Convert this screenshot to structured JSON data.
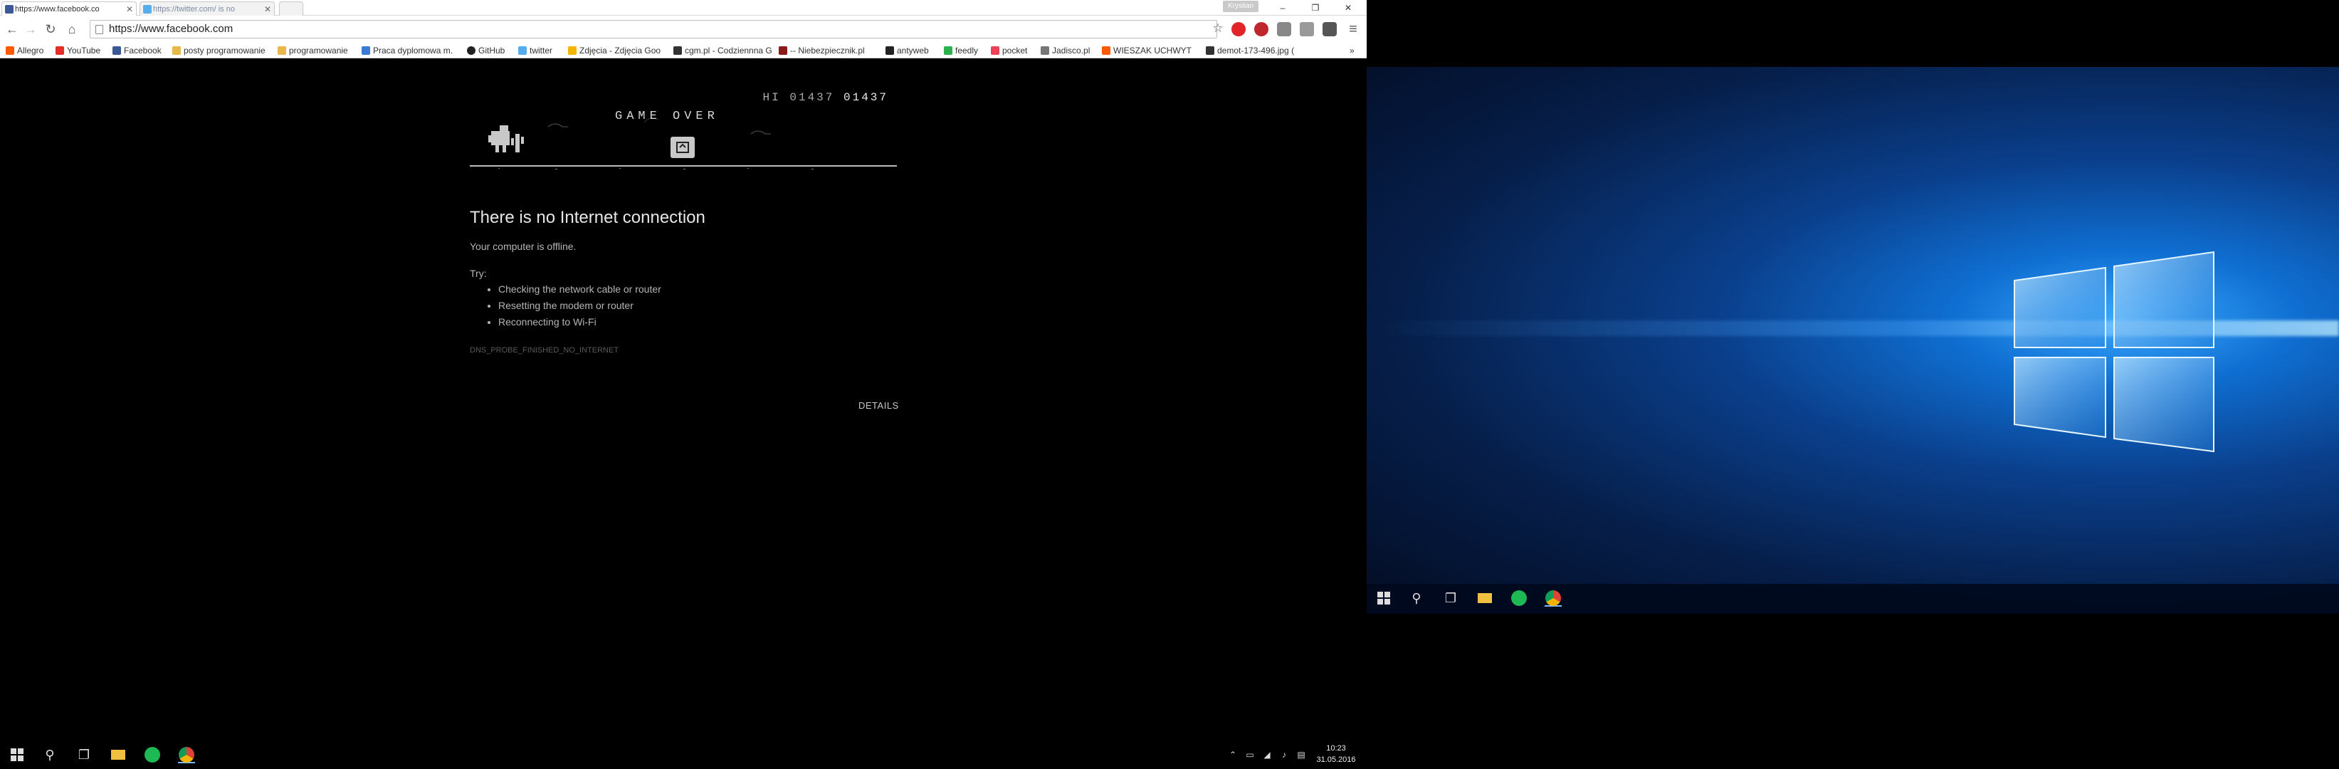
{
  "browser": {
    "tabs": [
      {
        "title": "https://www.facebook.co",
        "active": true,
        "favicon_color": "#3b5998"
      },
      {
        "title": "https://twitter.com/ is no",
        "active": false,
        "favicon_color": "#55acee"
      }
    ],
    "user_badge": "Krystian",
    "window_controls": {
      "minimize": "–",
      "restore": "❐",
      "close": "✕"
    },
    "toolbar": {
      "back": "←",
      "forward": "→",
      "reload": "↻",
      "home": "⌂",
      "url": "https://www.facebook.com",
      "star": "☆",
      "menu": "≡"
    },
    "extensions": [
      {
        "name": "opera-icon",
        "color": "#e0242a"
      },
      {
        "name": "adblock-icon",
        "color": "#c0262d"
      },
      {
        "name": "youtube-icon",
        "color": "#888888"
      },
      {
        "name": "cast-icon",
        "color": "#999999"
      },
      {
        "name": "pocket-icon",
        "color": "#555555"
      }
    ],
    "bookmarks": [
      {
        "label": "Allegro",
        "color": "#ff5a00"
      },
      {
        "label": "YouTube",
        "color": "#e52d27"
      },
      {
        "label": "Facebook",
        "color": "#3b5998"
      },
      {
        "label": "posty programowanie",
        "color": "#e8b84a"
      },
      {
        "label": "programowanie",
        "color": "#e8b84a"
      },
      {
        "label": "Praca dyplomowa m.",
        "color": "#3a7bd5"
      },
      {
        "label": "GitHub",
        "color": "#222222"
      },
      {
        "label": "twitter",
        "color": "#55acee"
      },
      {
        "label": "Zdjęcia - Zdjęcia Goo",
        "color": "#f4b400"
      },
      {
        "label": "cgm.pl - Codziennna G",
        "color": "#333333"
      },
      {
        "label": "-- Niebezpiecznik.pl",
        "color": "#8b1a1a"
      },
      {
        "label": "antyweb",
        "color": "#222222"
      },
      {
        "label": "feedly",
        "color": "#2bb24c"
      },
      {
        "label": "pocket",
        "color": "#ee4056"
      },
      {
        "label": "Jadisco.pl",
        "color": "#777777"
      },
      {
        "label": "WIESZAK UCHWYT I",
        "color": "#ff5a00"
      },
      {
        "label": "demot-173-496.jpg (",
        "color": "#333333"
      }
    ],
    "more_bookmarks": "»"
  },
  "error_page": {
    "game": {
      "hi_label": "HI",
      "hi_score": "01437",
      "current_score": "01437",
      "game_over": "GAME OVER"
    },
    "heading": "There is no Internet connection",
    "subtext": "Your computer is offline.",
    "try_label": "Try:",
    "suggestions": [
      "Checking the network cable or router",
      "Resetting the modem or router",
      "Reconnecting to Wi-Fi"
    ],
    "error_code": "DNS_PROBE_FINISHED_NO_INTERNET",
    "details_button": "DETAILS"
  },
  "taskbar_left": {
    "clock_time": "10:23",
    "clock_date": "31.05.2016"
  }
}
